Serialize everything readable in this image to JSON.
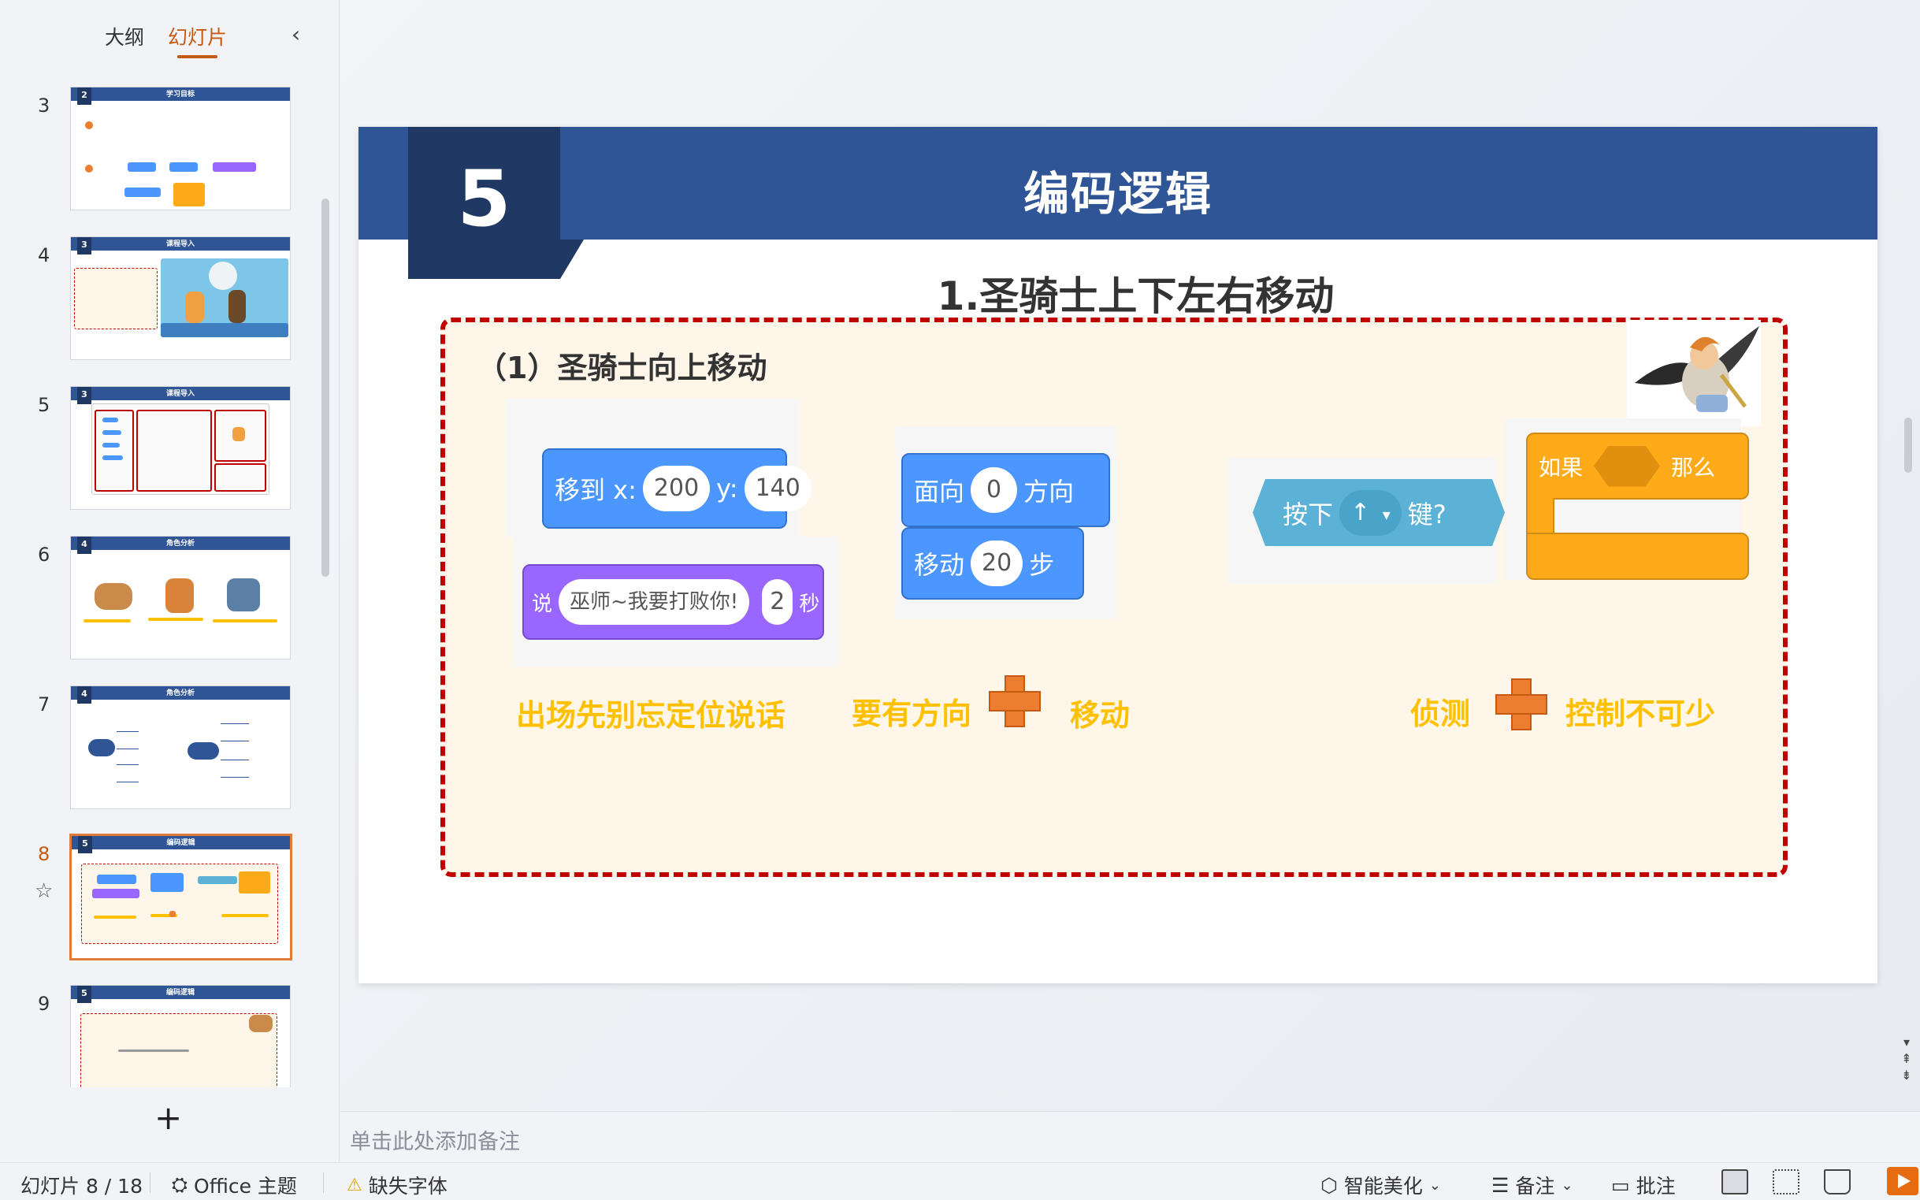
{
  "left_panel": {
    "tabs": [
      {
        "label": "大纲",
        "active": false
      },
      {
        "label": "幻灯片",
        "active": true
      }
    ],
    "collapse_icon": "chevron-left-icon",
    "thumbnails": [
      {
        "number": "3",
        "badge": "2",
        "title": "学习目标"
      },
      {
        "number": "4",
        "badge": "3",
        "title": "课程导入"
      },
      {
        "number": "5",
        "badge": "3",
        "title": "课程导入"
      },
      {
        "number": "6",
        "badge": "4",
        "title": "角色分析"
      },
      {
        "number": "7",
        "badge": "4",
        "title": "角色分析"
      },
      {
        "number": "8",
        "badge": "5",
        "title": "编码逻辑",
        "current": true
      },
      {
        "number": "9",
        "badge": "5",
        "title": "编码逻辑"
      }
    ],
    "add_slide_icon": "plus-icon"
  },
  "slide": {
    "number": "5",
    "title": "编码逻辑",
    "subtitle": "1.圣骑士上下左右移动",
    "section": "（1）圣骑士向上移动",
    "blocks": {
      "goto": {
        "label_x": "移到 x:",
        "x": "200",
        "label_y": "y:",
        "y": "140"
      },
      "say": {
        "label": "说",
        "text": "巫师~我要打败你!",
        "secs": "2",
        "unit": "秒"
      },
      "point": {
        "label": "面向",
        "value": "0",
        "unit": "方向"
      },
      "move": {
        "label": "移动",
        "value": "20",
        "unit": "步"
      },
      "key": {
        "label": "按下",
        "key": "↑",
        "suffix": "键?"
      },
      "if": {
        "label": "如果",
        "then": "那么"
      }
    },
    "tips": {
      "tip1": "出场先别忘定位说话",
      "tip2a": "要有方向",
      "tip2b": "移动",
      "tip3a": "侦测",
      "tip3b": "控制不可少"
    }
  },
  "notes": {
    "placeholder": "单击此处添加备注"
  },
  "status_bar": {
    "slide_counter": "幻灯片 8 / 18",
    "theme": "Office 主题",
    "missing_font": "缺失字体",
    "smart_beautify": "智能美化",
    "notes_btn": "备注",
    "comments_btn": "批注"
  },
  "colors": {
    "title_band": "#2f5597",
    "number_box": "#1f3864",
    "frame_border": "#c00000",
    "tip_text": "#ffc000",
    "accent": "#c55a11"
  }
}
